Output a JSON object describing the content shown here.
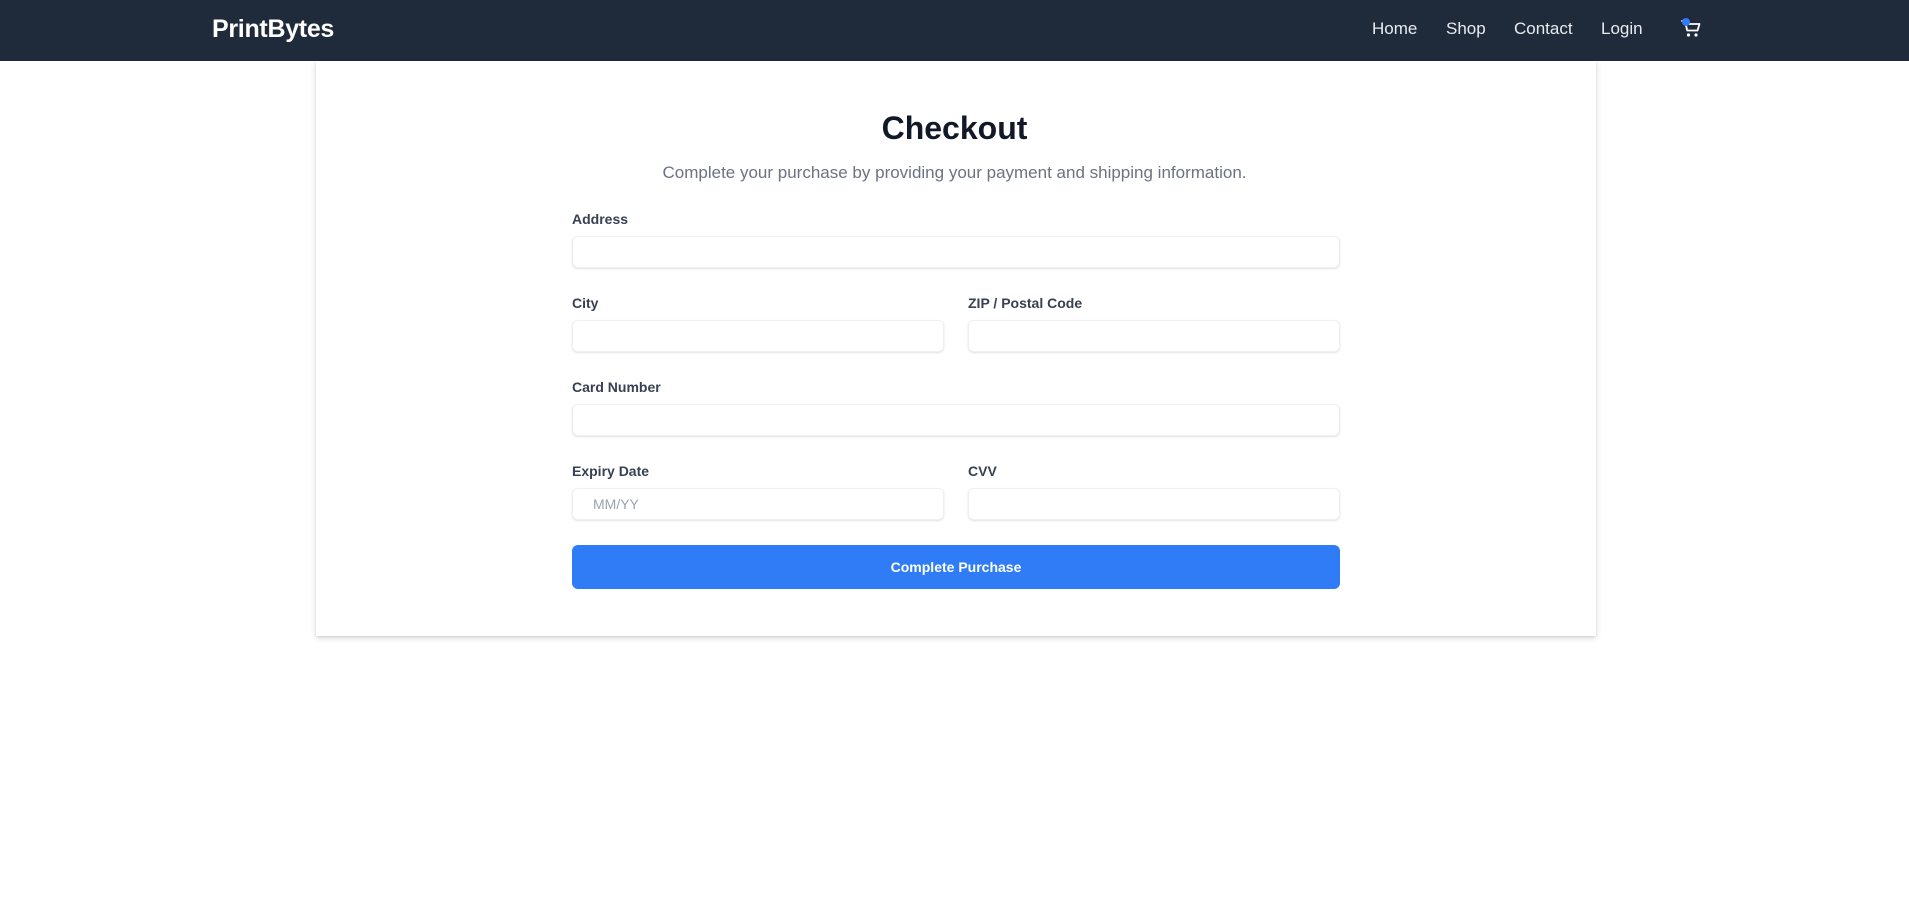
{
  "header": {
    "brand": "PrintBytes",
    "nav": [
      {
        "label": "Home"
      },
      {
        "label": "Shop"
      },
      {
        "label": "Contact"
      },
      {
        "label": "Login"
      }
    ],
    "cart_icon": "shopping-cart-icon"
  },
  "checkout": {
    "title": "Checkout",
    "subtitle": "Complete your purchase by providing your payment and shipping information.",
    "fields": {
      "address": {
        "label": "Address",
        "value": "",
        "placeholder": ""
      },
      "city": {
        "label": "City",
        "value": "",
        "placeholder": ""
      },
      "zip": {
        "label": "ZIP / Postal Code",
        "value": "",
        "placeholder": ""
      },
      "card_number": {
        "label": "Card Number",
        "value": "",
        "placeholder": ""
      },
      "expiry": {
        "label": "Expiry Date",
        "value": "",
        "placeholder": "MM/YY"
      },
      "cvv": {
        "label": "CVV",
        "value": "",
        "placeholder": ""
      }
    },
    "submit_label": "Complete Purchase"
  },
  "colors": {
    "header_bg": "#1f2a3a",
    "accent": "#2f7cf6"
  }
}
